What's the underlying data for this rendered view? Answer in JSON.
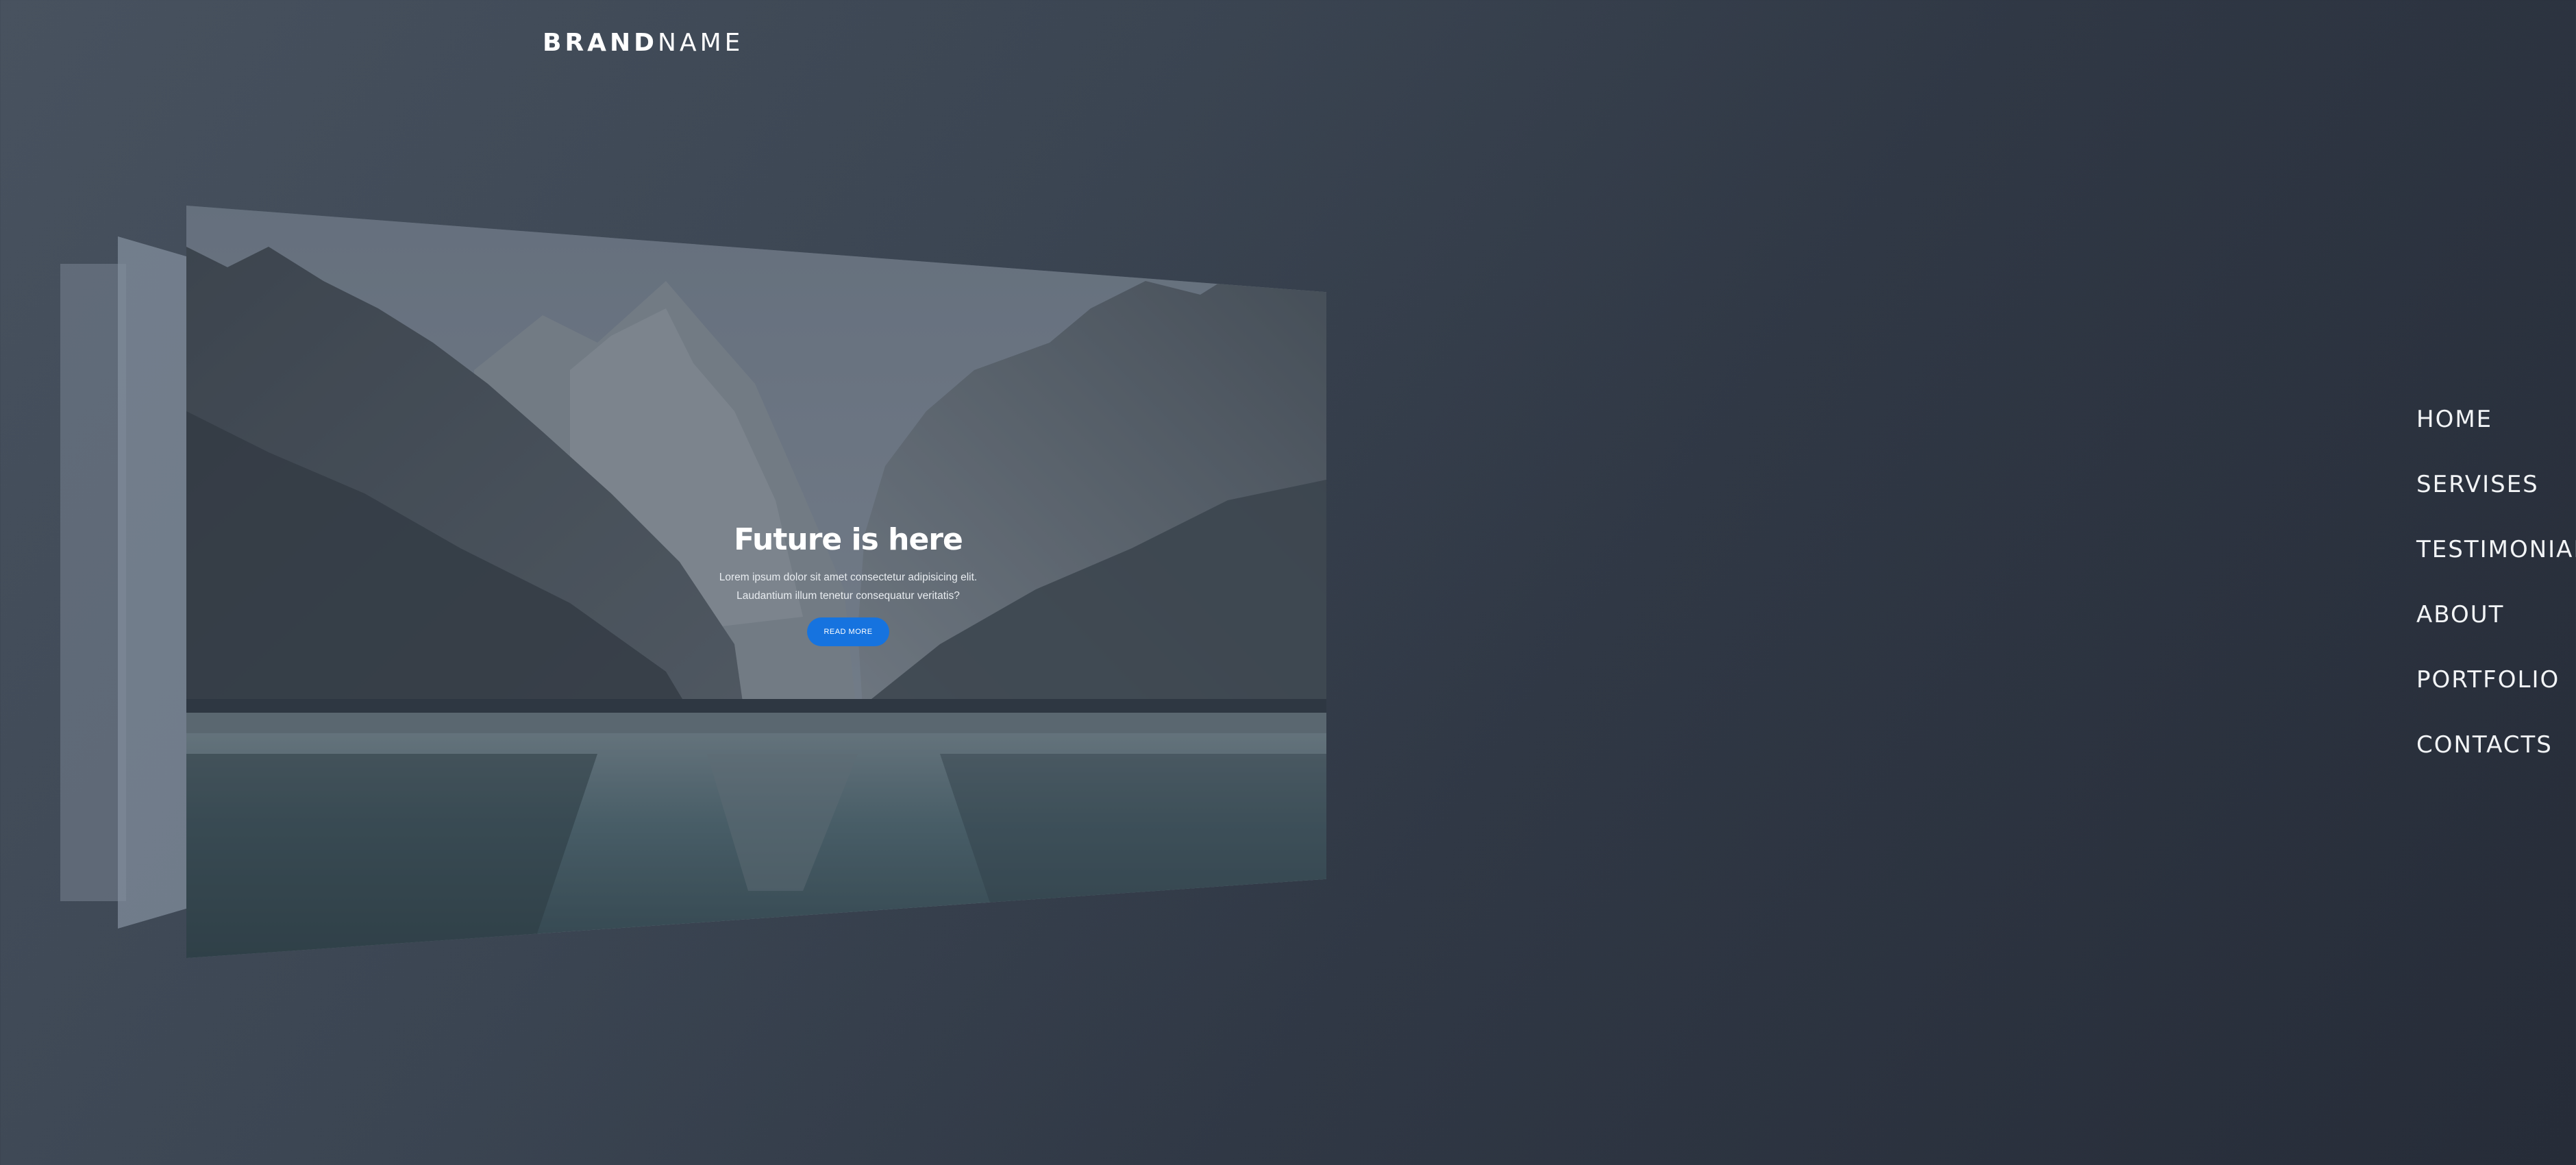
{
  "brand": {
    "bold": "BRAND",
    "light": "NAME"
  },
  "hero": {
    "title": "Future is here",
    "line1": "Lorem ipsum dolor sit amet consectetur adipisicing elit.",
    "line2": "Laudantium illum tenetur consequatur veritatis?",
    "button": "READ MORE"
  },
  "nav": {
    "items": [
      "HOME",
      "SERVISES",
      "TESTIMONIALS",
      "ABOUT",
      "PORTFOLIO",
      "CONTACTS"
    ]
  },
  "colors": {
    "accent": "#1673df",
    "background": "#363f4b"
  },
  "icons": {}
}
